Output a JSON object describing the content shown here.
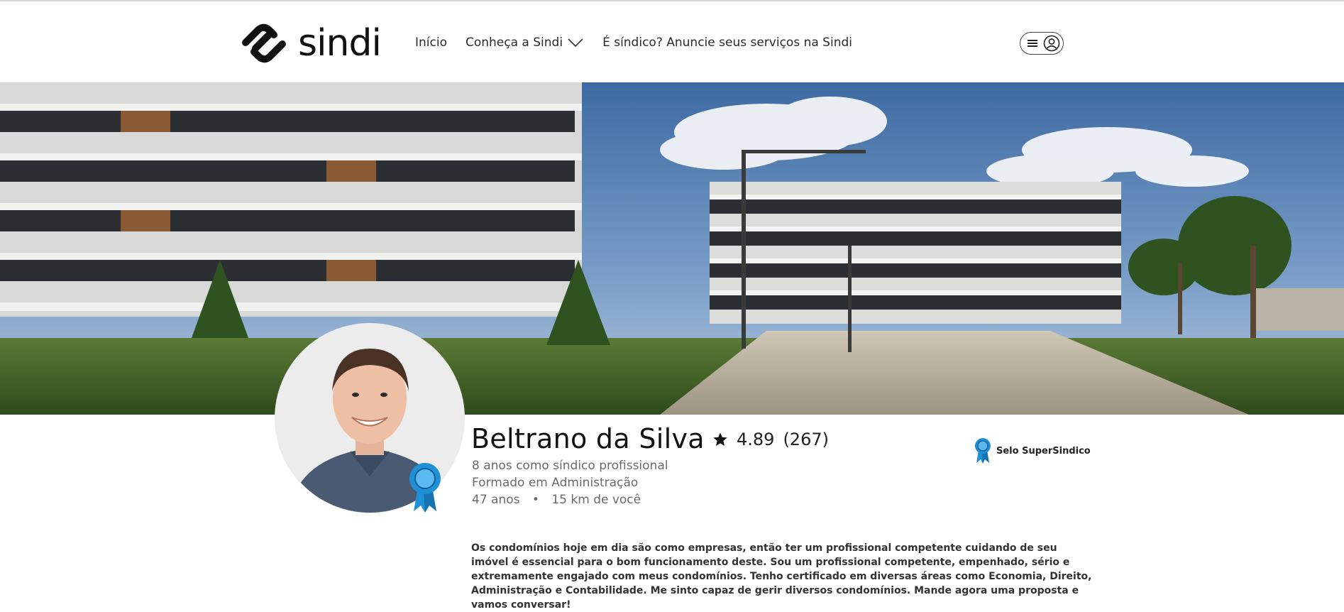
{
  "brand": {
    "name": "sindi"
  },
  "nav": {
    "inicio": "Início",
    "conheca": "Conheça a Sindi",
    "anuncie": "É síndico? Anuncie seus serviços na Sindi"
  },
  "user_menu": {
    "icons": [
      "hamburger-icon",
      "user-icon"
    ]
  },
  "profile": {
    "name": "Beltrano da Silva",
    "rating": "4.89",
    "reviews": "(267)",
    "experience": "8 anos como síndico profissional",
    "education": "Formado em Administração",
    "age": "47 anos",
    "separator": "•",
    "distance": "15 km de você",
    "seal_label": "Selo SuperSindico",
    "bio": "Os condomínios hoje em dia são como empresas, então ter um profissional competente cuidando de seu imóvel é essencial para o bom funcionamento deste. Sou um profissional competente, empenhado, sério e extremamente  engajado com meus condomínios. Tenho certificado  em diversas áreas como Economia, Direito, Administração e Contabilidade.  Me sinto capaz de gerir diversos condomínios. Mande agora uma proposta e vamos conversar!"
  },
  "colors": {
    "badge_blue": "#1f8fd6",
    "text_dark": "#111111",
    "text_muted": "#6a6a6a"
  }
}
